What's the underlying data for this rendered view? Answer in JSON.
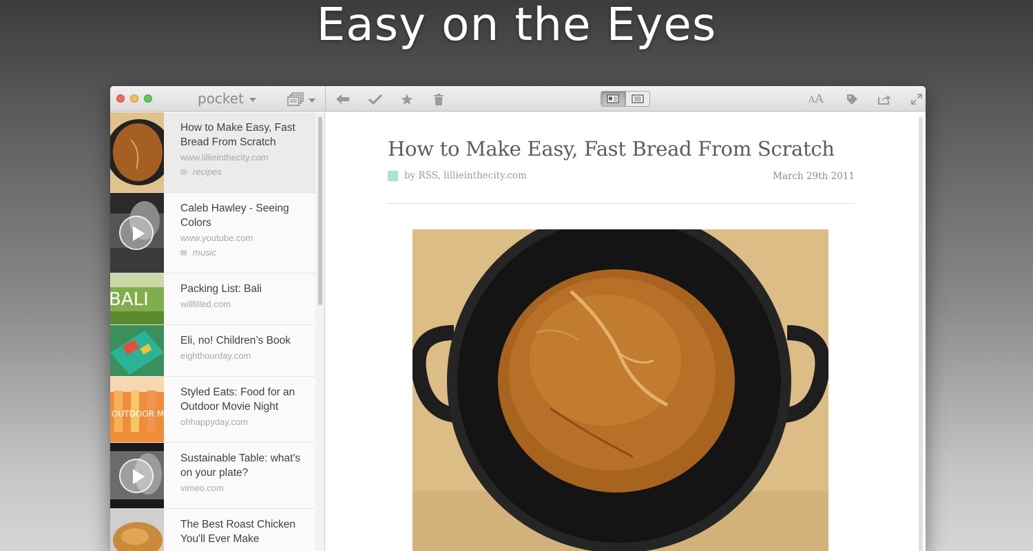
{
  "headline": "Easy on the Eyes",
  "app": {
    "brand": "pocket"
  },
  "toolbar": {
    "back_icon": "back-arrow-icon",
    "archive_icon": "checkmark-icon",
    "favorite_icon": "star-icon",
    "delete_icon": "trash-icon",
    "view_modes": [
      "article-view-icon",
      "web-view-icon"
    ],
    "active_view": "article-view-icon",
    "font_size_label_small": "A",
    "font_size_label_big": "A",
    "tag_icon": "tag-icon",
    "share_icon": "share-icon",
    "fullscreen_icon": "fullscreen-icon"
  },
  "list": {
    "items": [
      {
        "title": "How to Make Easy, Fast Bread From Scratch",
        "domain": "www.lillieinthecity.com",
        "tag": "recipes",
        "selected": true
      },
      {
        "title": "Caleb Hawley - Seeing Colors",
        "domain": "www.youtube.com",
        "tag": "music",
        "video": true
      },
      {
        "title": "Packing List: Bali",
        "domain": "willfilled.com",
        "thumb_text": "BALI"
      },
      {
        "title": "Eli, no! Children’s Book",
        "domain": "eighthourday.com"
      },
      {
        "title": "Styled Eats: Food for an Outdoor Movie Night",
        "domain": "ohhappyday.com",
        "thumb_text": "OUTDOOR MOVIE NI"
      },
      {
        "title": "Sustainable Table: what's on your plate?",
        "domain": "vimeo.com",
        "video": true
      },
      {
        "title": "The Best Roast Chicken You'll Ever Make",
        "domain": ""
      }
    ]
  },
  "article": {
    "title": "How to Make Easy, Fast Bread From Scratch",
    "byline": "by RSS, lillieinthecity.com",
    "date": "March 29th 2011",
    "source_color": "#a8e6cc"
  }
}
